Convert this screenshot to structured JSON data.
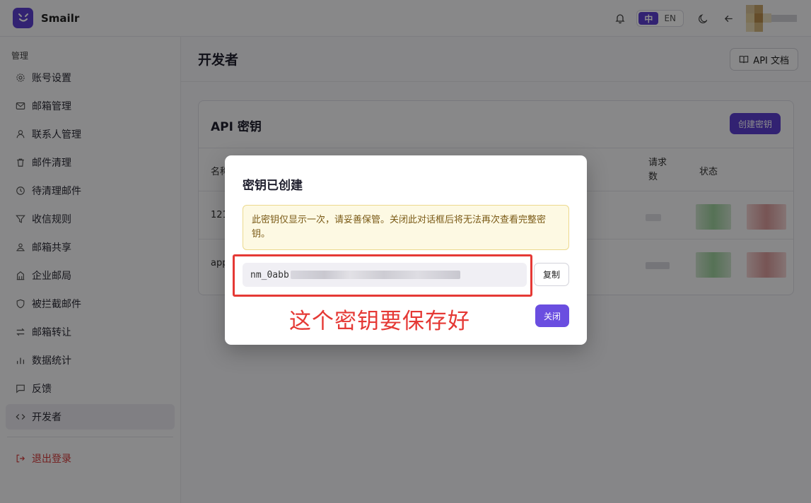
{
  "app": {
    "name": "Smailr"
  },
  "topbar": {
    "lang_zh": "中",
    "lang_en": "EN"
  },
  "sidebar": {
    "section_title": "管理",
    "items": [
      {
        "label": "账号设置",
        "icon": "gear-icon"
      },
      {
        "label": "邮箱管理",
        "icon": "mail-icon"
      },
      {
        "label": "联系人管理",
        "icon": "user-icon"
      },
      {
        "label": "邮件清理",
        "icon": "trash-icon"
      },
      {
        "label": "待清理邮件",
        "icon": "clock-icon"
      },
      {
        "label": "收信规则",
        "icon": "filter-icon"
      },
      {
        "label": "邮箱共享",
        "icon": "share-icon"
      },
      {
        "label": "企业邮局",
        "icon": "building-icon"
      },
      {
        "label": "被拦截邮件",
        "icon": "shield-icon"
      },
      {
        "label": "邮箱转让",
        "icon": "transfer-icon"
      },
      {
        "label": "数据统计",
        "icon": "chart-icon"
      },
      {
        "label": "反馈",
        "icon": "message-icon"
      },
      {
        "label": "开发者",
        "icon": "code-icon",
        "active": true
      }
    ],
    "logout": "退出登录"
  },
  "main": {
    "title": "开发者",
    "docs_button": "API 文档",
    "card": {
      "title": "API 密钥",
      "create_button": "创建密钥",
      "columns": {
        "name": "名称",
        "requests": "请求\n数",
        "status": "状态"
      },
      "rows": [
        {
          "name": "121"
        },
        {
          "name": "app"
        }
      ]
    }
  },
  "modal": {
    "title": "密钥已创建",
    "warning": "此密钥仅显示一次，请妥善保管。关闭此对话框后将无法再次查看完整密钥。",
    "key_prefix": "nm_0abb",
    "copy_button": "复制",
    "close_button": "关闭"
  },
  "annotation": {
    "text": "这个密钥要保存好",
    "color": "#e53935"
  },
  "colors": {
    "accent": "#5b3fd0",
    "danger": "#d23a3a"
  }
}
